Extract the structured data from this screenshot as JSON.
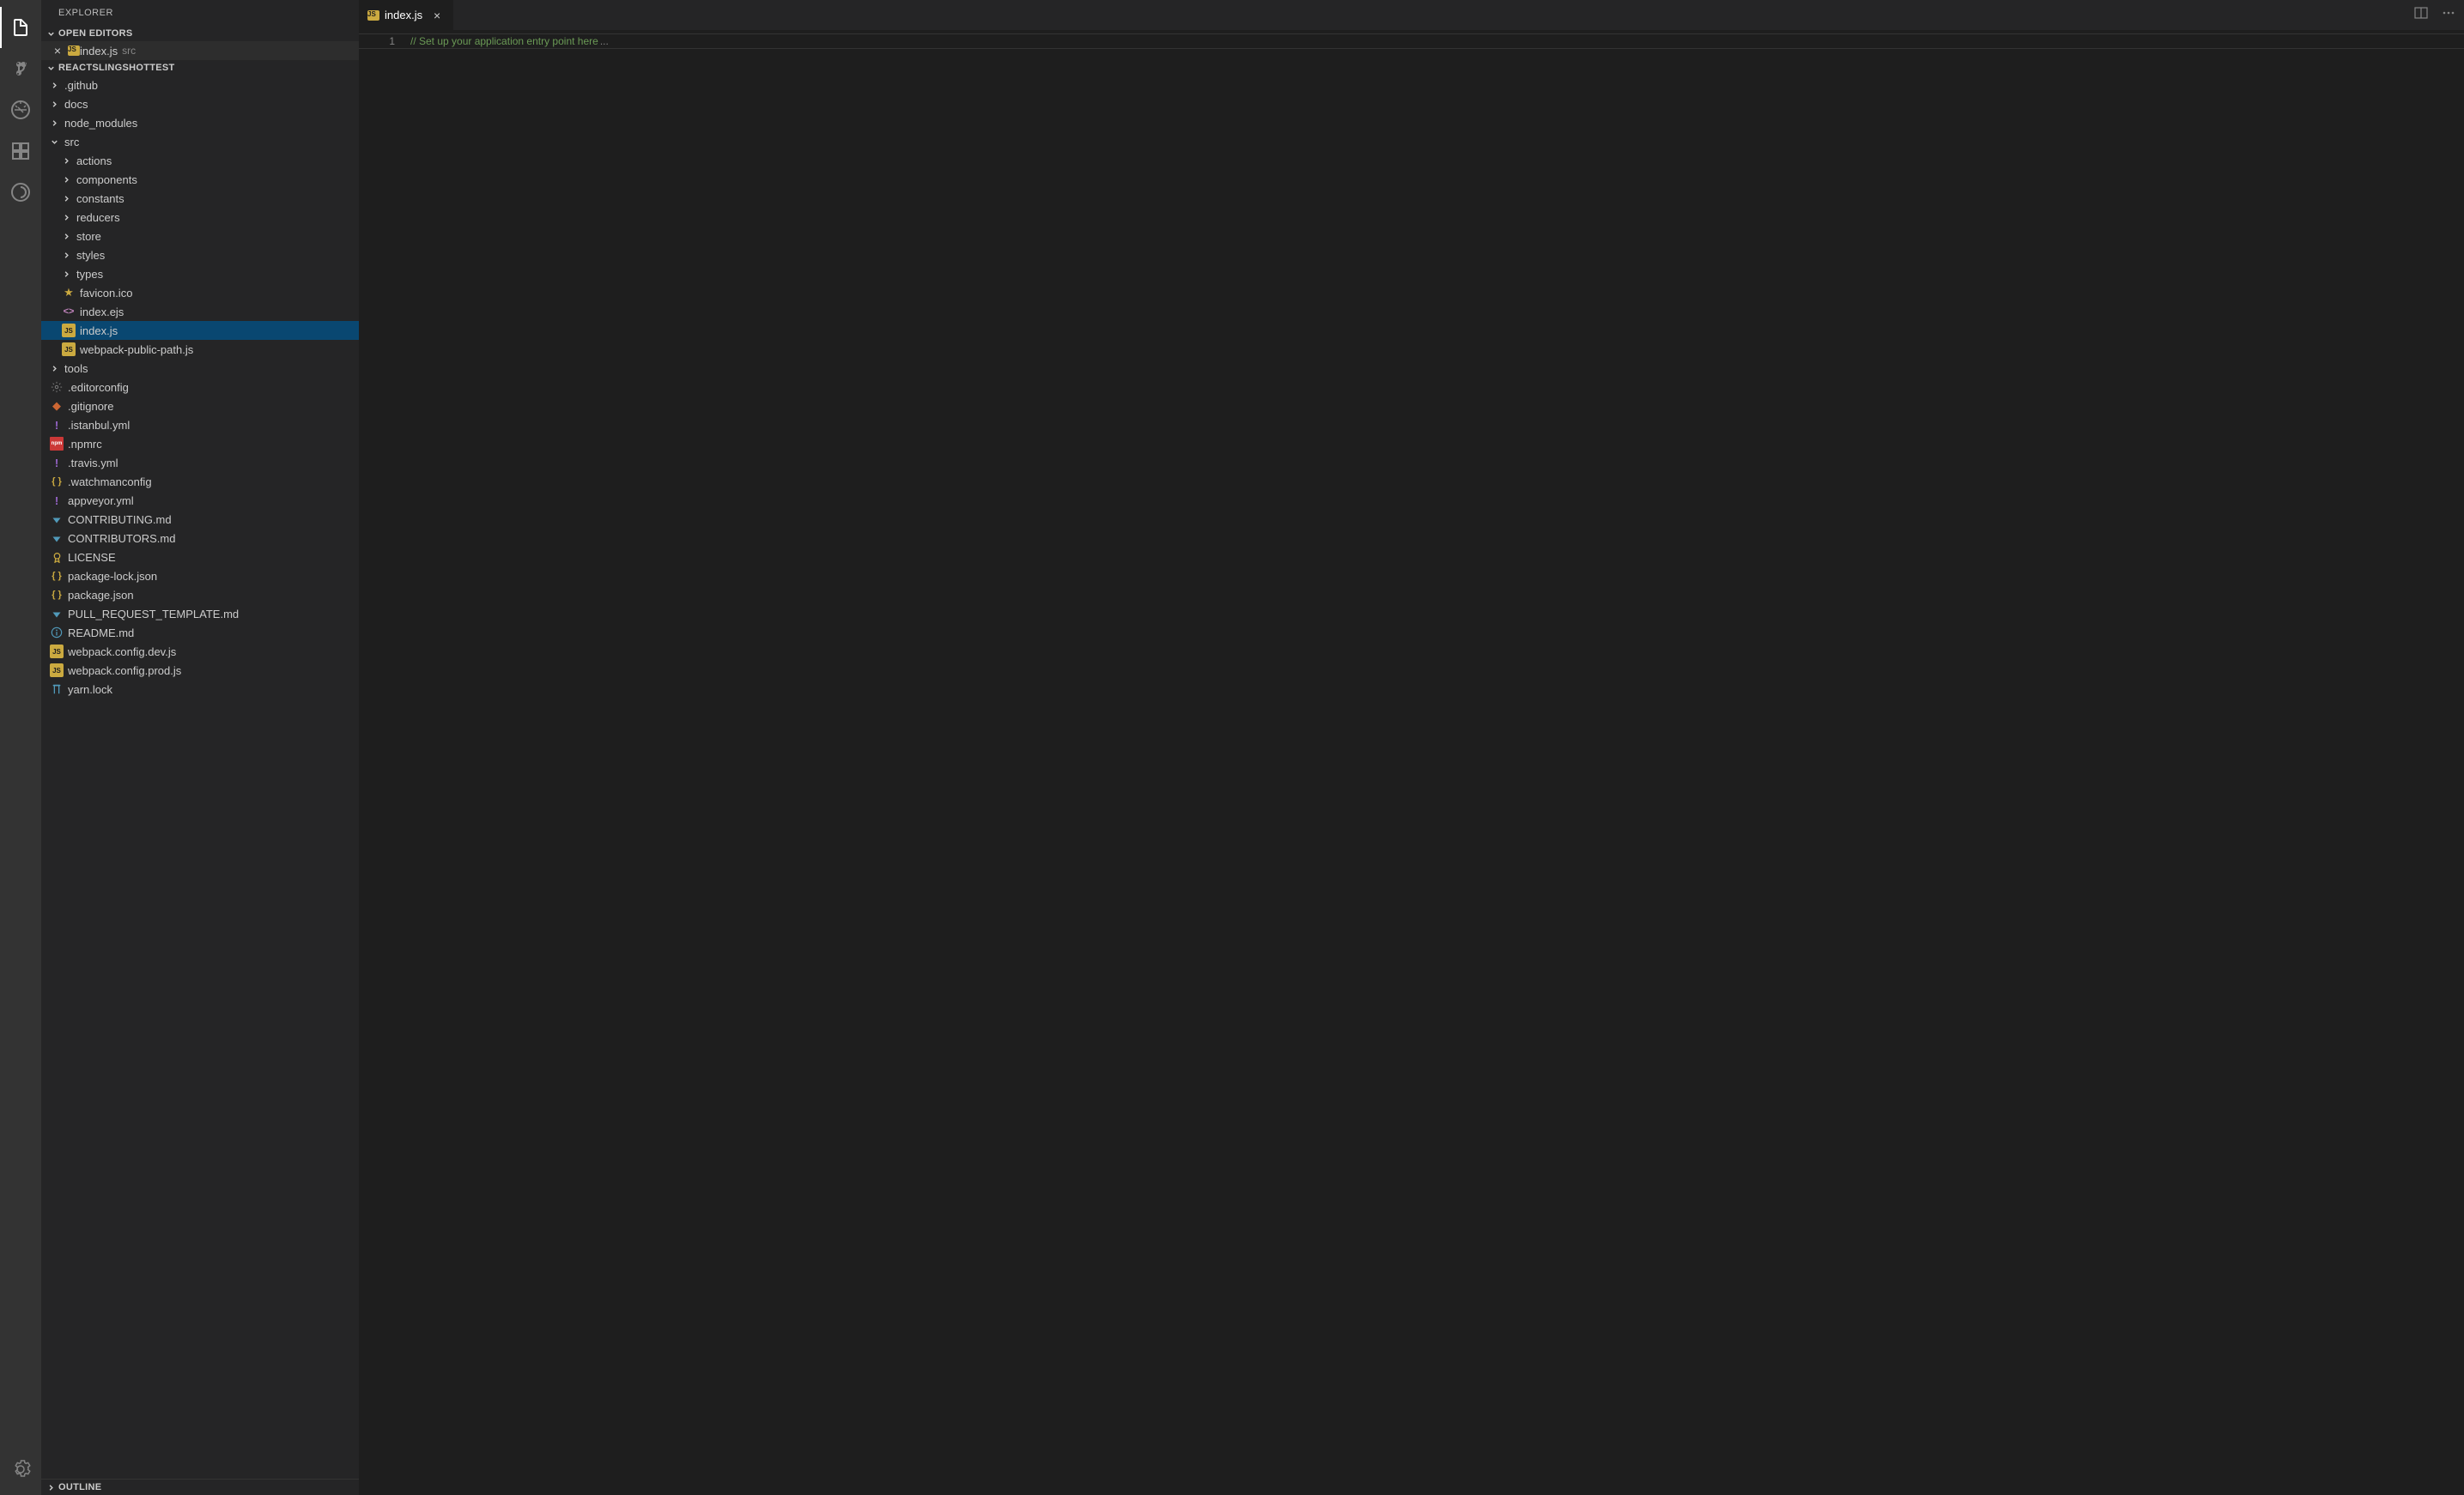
{
  "sidebar_title": "EXPLORER",
  "sections": {
    "open_editors": "OPEN EDITORS",
    "project_name": "REACTSLINGSHOTTEST",
    "outline": "OUTLINE"
  },
  "open_editor": {
    "name": "index.js",
    "path": "src"
  },
  "tree": [
    {
      "name": ".github",
      "kind": "folder",
      "pad": 0,
      "expanded": false
    },
    {
      "name": "docs",
      "kind": "folder",
      "pad": 0,
      "expanded": false
    },
    {
      "name": "node_modules",
      "kind": "folder",
      "pad": 0,
      "expanded": false
    },
    {
      "name": "src",
      "kind": "folder",
      "pad": 0,
      "expanded": true
    },
    {
      "name": "actions",
      "kind": "folder",
      "pad": 1,
      "expanded": false
    },
    {
      "name": "components",
      "kind": "folder",
      "pad": 1,
      "expanded": false
    },
    {
      "name": "constants",
      "kind": "folder",
      "pad": 1,
      "expanded": false
    },
    {
      "name": "reducers",
      "kind": "folder",
      "pad": 1,
      "expanded": false
    },
    {
      "name": "store",
      "kind": "folder",
      "pad": 1,
      "expanded": false
    },
    {
      "name": "styles",
      "kind": "folder",
      "pad": 1,
      "expanded": false
    },
    {
      "name": "types",
      "kind": "folder",
      "pad": 1,
      "expanded": false
    },
    {
      "name": "favicon.ico",
      "kind": "file",
      "icon": "star",
      "pad": 1
    },
    {
      "name": "index.ejs",
      "kind": "file",
      "icon": "code",
      "pad": 1
    },
    {
      "name": "index.js",
      "kind": "file",
      "icon": "js",
      "pad": 1,
      "selected": true
    },
    {
      "name": "webpack-public-path.js",
      "kind": "file",
      "icon": "js",
      "pad": 1
    },
    {
      "name": "tools",
      "kind": "folder",
      "pad": 0,
      "expanded": false
    },
    {
      "name": ".editorconfig",
      "kind": "file",
      "icon": "gear",
      "pad": 0
    },
    {
      "name": ".gitignore",
      "kind": "file",
      "icon": "git",
      "pad": 0
    },
    {
      "name": ".istanbul.yml",
      "kind": "file",
      "icon": "exc",
      "pad": 0
    },
    {
      "name": ".npmrc",
      "kind": "file",
      "icon": "npm",
      "pad": 0
    },
    {
      "name": ".travis.yml",
      "kind": "file",
      "icon": "exc",
      "pad": 0
    },
    {
      "name": ".watchmanconfig",
      "kind": "file",
      "icon": "json",
      "pad": 0
    },
    {
      "name": "appveyor.yml",
      "kind": "file",
      "icon": "exc",
      "pad": 0
    },
    {
      "name": "CONTRIBUTING.md",
      "kind": "file",
      "icon": "down",
      "pad": 0
    },
    {
      "name": "CONTRIBUTORS.md",
      "kind": "file",
      "icon": "down",
      "pad": 0
    },
    {
      "name": "LICENSE",
      "kind": "file",
      "icon": "cert",
      "pad": 0
    },
    {
      "name": "package-lock.json",
      "kind": "file",
      "icon": "json",
      "pad": 0
    },
    {
      "name": "package.json",
      "kind": "file",
      "icon": "json",
      "pad": 0
    },
    {
      "name": "PULL_REQUEST_TEMPLATE.md",
      "kind": "file",
      "icon": "down",
      "pad": 0
    },
    {
      "name": "README.md",
      "kind": "file",
      "icon": "info",
      "pad": 0
    },
    {
      "name": "webpack.config.dev.js",
      "kind": "file",
      "icon": "js",
      "pad": 0
    },
    {
      "name": "webpack.config.prod.js",
      "kind": "file",
      "icon": "js",
      "pad": 0
    },
    {
      "name": "yarn.lock",
      "kind": "file",
      "icon": "yarn",
      "pad": 0
    }
  ],
  "tab": {
    "name": "index.js"
  },
  "editor": {
    "line_number": "1",
    "line_content": "// Set up your application entry point here",
    "dots": "..."
  }
}
